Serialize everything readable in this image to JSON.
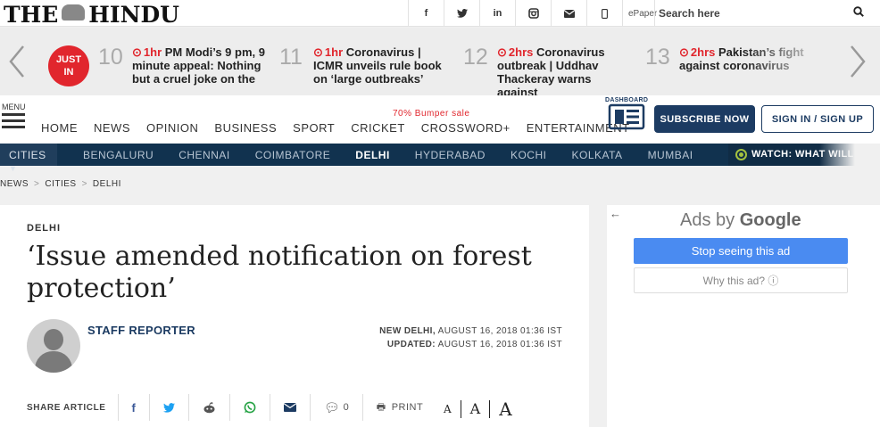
{
  "header": {
    "logo_left": "THE",
    "logo_right": "HINDU",
    "social": [
      {
        "icon": "facebook-icon",
        "glyph": "f"
      },
      {
        "icon": "twitter-icon",
        "glyph": "𝕥"
      },
      {
        "icon": "linkedin-icon",
        "glyph": "in"
      },
      {
        "icon": "instagram-icon",
        "glyph": "◙"
      },
      {
        "icon": "mail-icon",
        "glyph": "✉"
      },
      {
        "icon": "mobile-icon",
        "glyph": "▯"
      }
    ],
    "epaper": "ePaper",
    "search_placeholder": "Search here"
  },
  "ticker": {
    "badge_line1": "JUST",
    "badge_line2": "IN",
    "items": [
      {
        "num": "10",
        "time": "1hr",
        "text": "PM Modi’s 9 pm, 9 minute appeal: Nothing but a cruel joke on the"
      },
      {
        "num": "11",
        "time": "1hr",
        "text": "Coronavirus | ICMR unveils rule book on ‘large outbreaks’"
      },
      {
        "num": "12",
        "time": "2hrs",
        "text": "Coronavirus outbreak | Uddhav Thackeray warns against"
      },
      {
        "num": "13",
        "time": "2hrs",
        "text": "Pakistan’s fight against coronavirus"
      }
    ]
  },
  "nav": {
    "menu_label": "MENU",
    "links": [
      "HOME",
      "NEWS",
      "OPINION",
      "BUSINESS",
      "SPORT",
      "CRICKET",
      "CROSSWORD+",
      "ENTERTAINMENT"
    ],
    "bumper": "70% Bumper sale",
    "dashboard_label": "DASHBOARD",
    "subscribe": "SUBSCRIBE NOW",
    "signin": "SIGN IN / SIGN UP"
  },
  "citybar": {
    "label": "CITIES",
    "cities": [
      "BENGALURU",
      "CHENNAI",
      "COIMBATORE",
      "DELHI",
      "HYDERABAD",
      "KOCHI",
      "KOLKATA",
      "MUMBAI"
    ],
    "active_city": "DELHI",
    "watch": "WATCH: WHAT WILL"
  },
  "breadcrumb": [
    "NEWS",
    "CITIES",
    "DELHI"
  ],
  "article": {
    "section": "DELHI",
    "headline": "‘Issue amended notification on forest protection’",
    "author": "STAFF REPORTER",
    "location": "NEW DELHI,",
    "published": "AUGUST 16, 2018 01:36 IST",
    "updated_label": "UPDATED:",
    "updated": "AUGUST 16, 2018 01:36 IST",
    "share_label": "SHARE ARTICLE",
    "comment_count": "0",
    "print_label": "PRINT",
    "font_sizes": [
      "A",
      "A",
      "A"
    ]
  },
  "ad": {
    "back_arrow": "←",
    "ads_by": "Ads by",
    "google": "Google",
    "stop": "Stop seeing this ad",
    "why": "Why this ad? ⓘ"
  },
  "colors": {
    "brand_navy": "#1c3b62",
    "city_bar": "#11324f",
    "accent_red": "#e1262d",
    "google_blue": "#4a8bf1"
  }
}
